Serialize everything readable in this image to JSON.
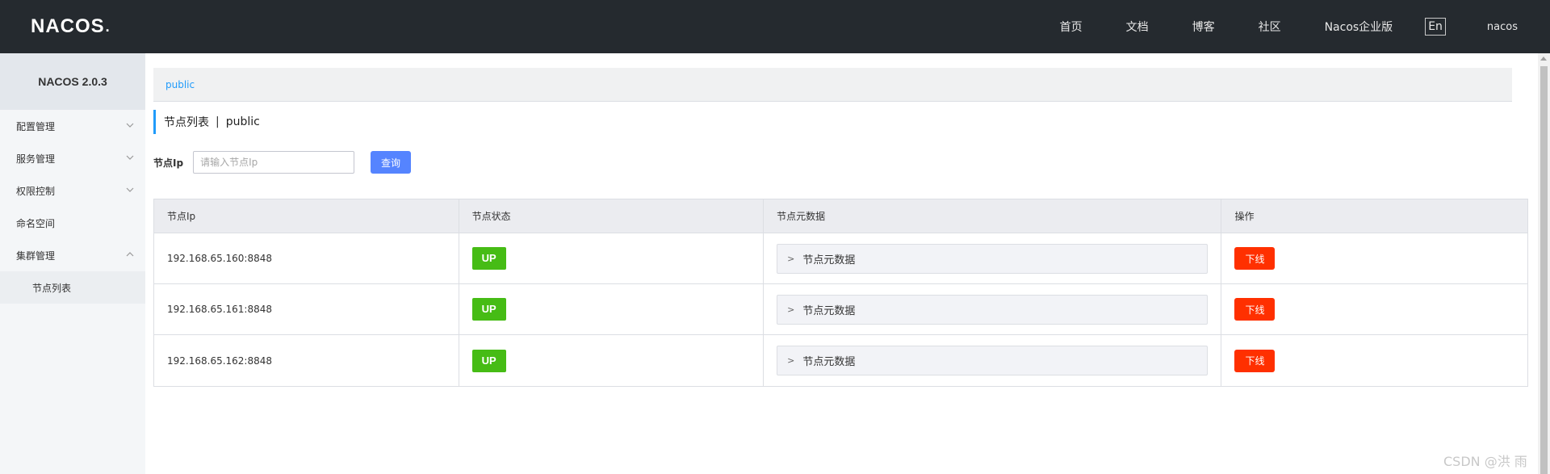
{
  "header": {
    "logo": "NACOS",
    "logo_dot": ".",
    "nav": [
      "首页",
      "文档",
      "博客",
      "社区",
      "Nacos企业版"
    ],
    "lang": "En",
    "user": "nacos"
  },
  "sidebar": {
    "title": "NACOS 2.0.3",
    "items": [
      {
        "label": "配置管理",
        "expanded": false
      },
      {
        "label": "服务管理",
        "expanded": false
      },
      {
        "label": "权限控制",
        "expanded": false
      },
      {
        "label": "命名空间"
      },
      {
        "label": "集群管理",
        "expanded": true
      }
    ],
    "subitems": [
      "节点列表"
    ]
  },
  "main": {
    "breadcrumb": "public",
    "title": "节点列表",
    "title_sep": "|",
    "title_namespace": "public",
    "search_label": "节点Ip",
    "search_placeholder": "请输入节点Ip",
    "query_button": "查询",
    "table": {
      "headers": [
        "节点Ip",
        "节点状态",
        "节点元数据",
        "操作"
      ],
      "rows": [
        {
          "ip": "192.168.65.160:8848",
          "status": "UP",
          "metadata": "节点元数据",
          "action": "下线"
        },
        {
          "ip": "192.168.65.161:8848",
          "status": "UP",
          "metadata": "节点元数据",
          "action": "下线"
        },
        {
          "ip": "192.168.65.162:8848",
          "status": "UP",
          "metadata": "节点元数据",
          "action": "下线"
        }
      ]
    }
  },
  "watermark": "CSDN @洪 雨",
  "colors": {
    "header_bg": "#252a2f",
    "accent": "#209bfa",
    "query_button": "#5584ff",
    "status_up": "#46bc15",
    "offline_button": "#ff3000"
  }
}
